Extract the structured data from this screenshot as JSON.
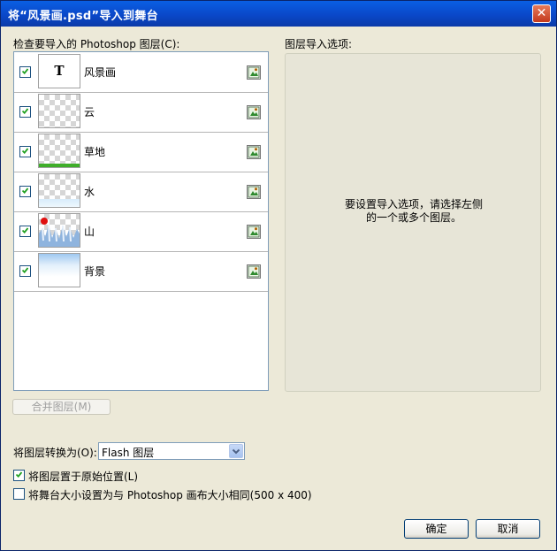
{
  "window": {
    "title": "将“风景画.psd”导入到舞台",
    "close_glyph": "✕"
  },
  "layers_section": {
    "label": "检查要导入的 Photoshop 图层(C):"
  },
  "layers": [
    {
      "name": "风景画",
      "checked": true,
      "thumb_glyph": "T"
    },
    {
      "name": "云",
      "checked": true
    },
    {
      "name": "草地",
      "checked": true
    },
    {
      "name": "水",
      "checked": true
    },
    {
      "name": "山",
      "checked": true
    },
    {
      "name": "背景",
      "checked": true
    }
  ],
  "options_section": {
    "label": "图层导入选项:",
    "message_line1": "要设置导入选项，请选择左侧",
    "message_line2": "的一个或多个图层。"
  },
  "merge_button": {
    "label": "合并图层(M)"
  },
  "convert": {
    "label": "将图层转换为(O):",
    "selected": "Flash 图层"
  },
  "options": {
    "keep_position": {
      "label": "将图层置于原始位置(L)",
      "checked": true
    },
    "stage_size": {
      "label": "将舞台大小设置为与 Photoshop 画布大小相同(500 x 400)",
      "checked": false
    }
  },
  "buttons": {
    "ok": "确定",
    "cancel": "取消"
  },
  "colors": {
    "titlebar": "#0a48c9",
    "check": "#21a121",
    "dialog_bg": "#ece9d8"
  }
}
